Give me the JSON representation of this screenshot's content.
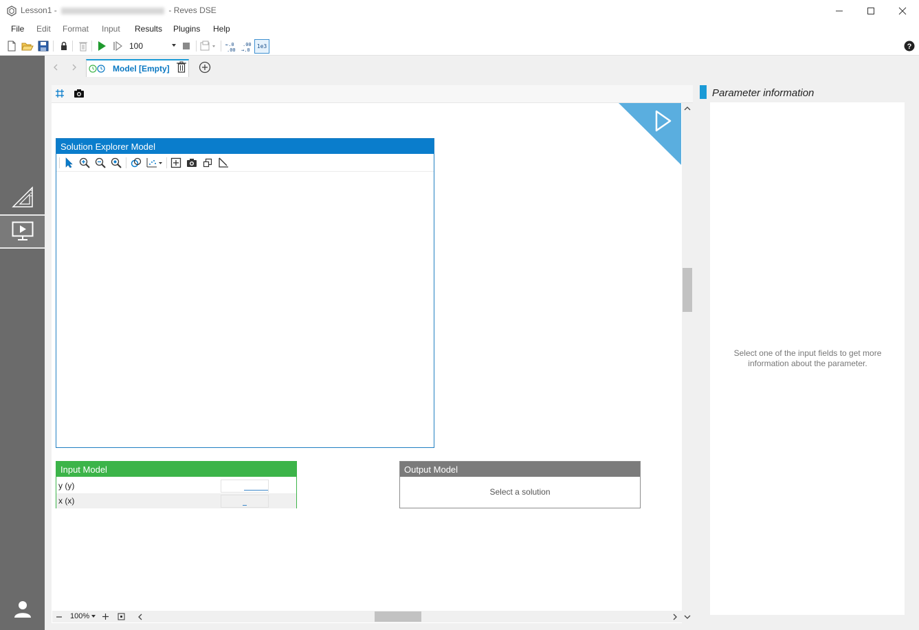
{
  "window": {
    "title_prefix": "Lesson1 -",
    "title_suffix": "- Reves DSE"
  },
  "menu": {
    "items": [
      {
        "label": "File",
        "enabled": true
      },
      {
        "label": "Edit",
        "enabled": false
      },
      {
        "label": "Format",
        "enabled": false
      },
      {
        "label": "Input",
        "enabled": false
      },
      {
        "label": "Results",
        "enabled": true
      },
      {
        "label": "Plugins",
        "enabled": true
      },
      {
        "label": "Help",
        "enabled": true
      }
    ]
  },
  "toolbar": {
    "steps_value": "100",
    "decimals_add_label": "+.0 .00",
    "decimals_remove_label": ".00 →.0",
    "scientific_label": "1e3"
  },
  "tabs": {
    "model_tab_label": "Model [Empty]"
  },
  "solution_explorer": {
    "title": "Solution Explorer Model"
  },
  "input_model": {
    "title": "Input Model",
    "rows": [
      {
        "label": "y (y)",
        "value": ""
      },
      {
        "label": "x (x)",
        "value": ""
      }
    ]
  },
  "output_model": {
    "title": "Output Model",
    "message": "Select a solution"
  },
  "zoom": {
    "level": "100%"
  },
  "parameter_info": {
    "title": "Parameter information",
    "message": "Select one of the input fields to get more information about the parameter."
  },
  "colors": {
    "accent_blue": "#0a7dcc",
    "input_green": "#3cb449",
    "output_gray": "#7b7b7b",
    "sidebar_gray": "#6b6b6b"
  }
}
